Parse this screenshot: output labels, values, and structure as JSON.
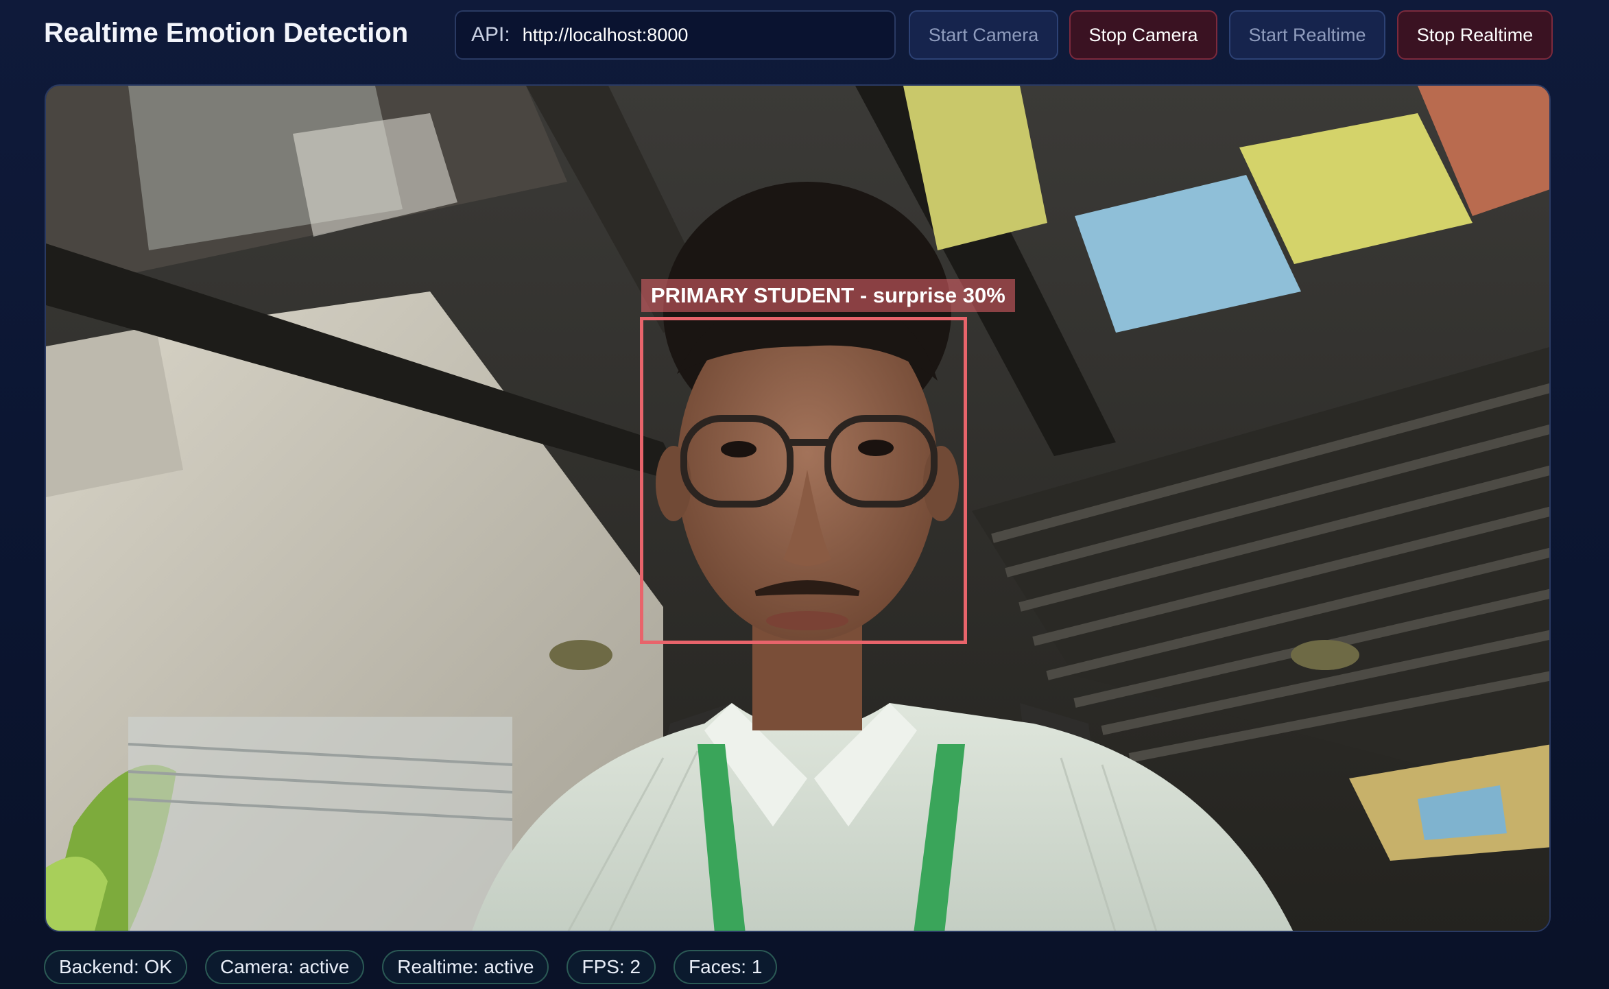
{
  "app": {
    "title": "Realtime Emotion Detection"
  },
  "api": {
    "label": "API:",
    "value": "http://localhost:8000"
  },
  "controls": {
    "start_camera": "Start Camera",
    "stop_camera": "Stop Camera",
    "start_realtime": "Start Realtime",
    "stop_realtime": "Stop Realtime"
  },
  "detection": {
    "label": "PRIMARY STUDENT - surprise 30%",
    "box_color": "#e8646b"
  },
  "status": {
    "backend": "Backend: OK",
    "camera": "Camera: active",
    "realtime": "Realtime: active",
    "fps": "FPS: 2",
    "faces": "Faces: 1"
  },
  "colors": {
    "background": "#0d1733",
    "start_button": "#16244d",
    "stop_button": "#3a1222",
    "chip_border": "#2b5a55"
  }
}
